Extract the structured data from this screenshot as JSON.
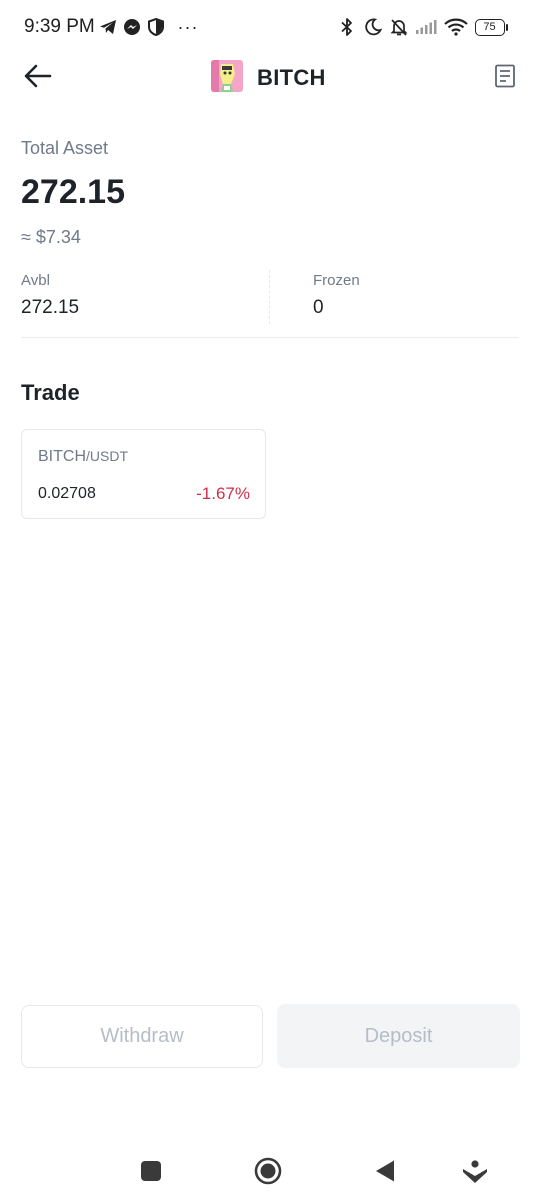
{
  "status_bar": {
    "time": "9:39 PM",
    "dots": "···",
    "battery": "75",
    "icons": [
      "telegram-icon",
      "messenger-icon",
      "shield-icon",
      "bluetooth-icon",
      "moon-icon",
      "bell-off-icon",
      "signal-icon",
      "wifi-icon",
      "battery-icon"
    ]
  },
  "header": {
    "title": "BITCH",
    "back_icon": "arrow-left-icon",
    "history_icon": "document-icon"
  },
  "asset": {
    "total_label": "Total Asset",
    "total_value": "272.15",
    "usd_value": "≈ $7.34",
    "avbl_label": "Avbl",
    "avbl_value": "272.15",
    "frozen_label": "Frozen",
    "frozen_value": "0"
  },
  "trade": {
    "heading": "Trade",
    "pairs": [
      {
        "base": "BITCH",
        "quote": "/USDT",
        "price": "0.02708",
        "change": "-1.67%"
      }
    ]
  },
  "actions": {
    "withdraw_label": "Withdraw",
    "deposit_label": "Deposit"
  },
  "nav_bar": {
    "icons": [
      "square-icon",
      "circle-home-icon",
      "triangle-back-icon",
      "assistant-icon"
    ]
  },
  "colors": {
    "primary_text": "#1e2329",
    "secondary_text": "#707a8a",
    "negative": "#cf304a",
    "disabled_text": "#b7bdc6",
    "border": "#e6e8ea"
  }
}
